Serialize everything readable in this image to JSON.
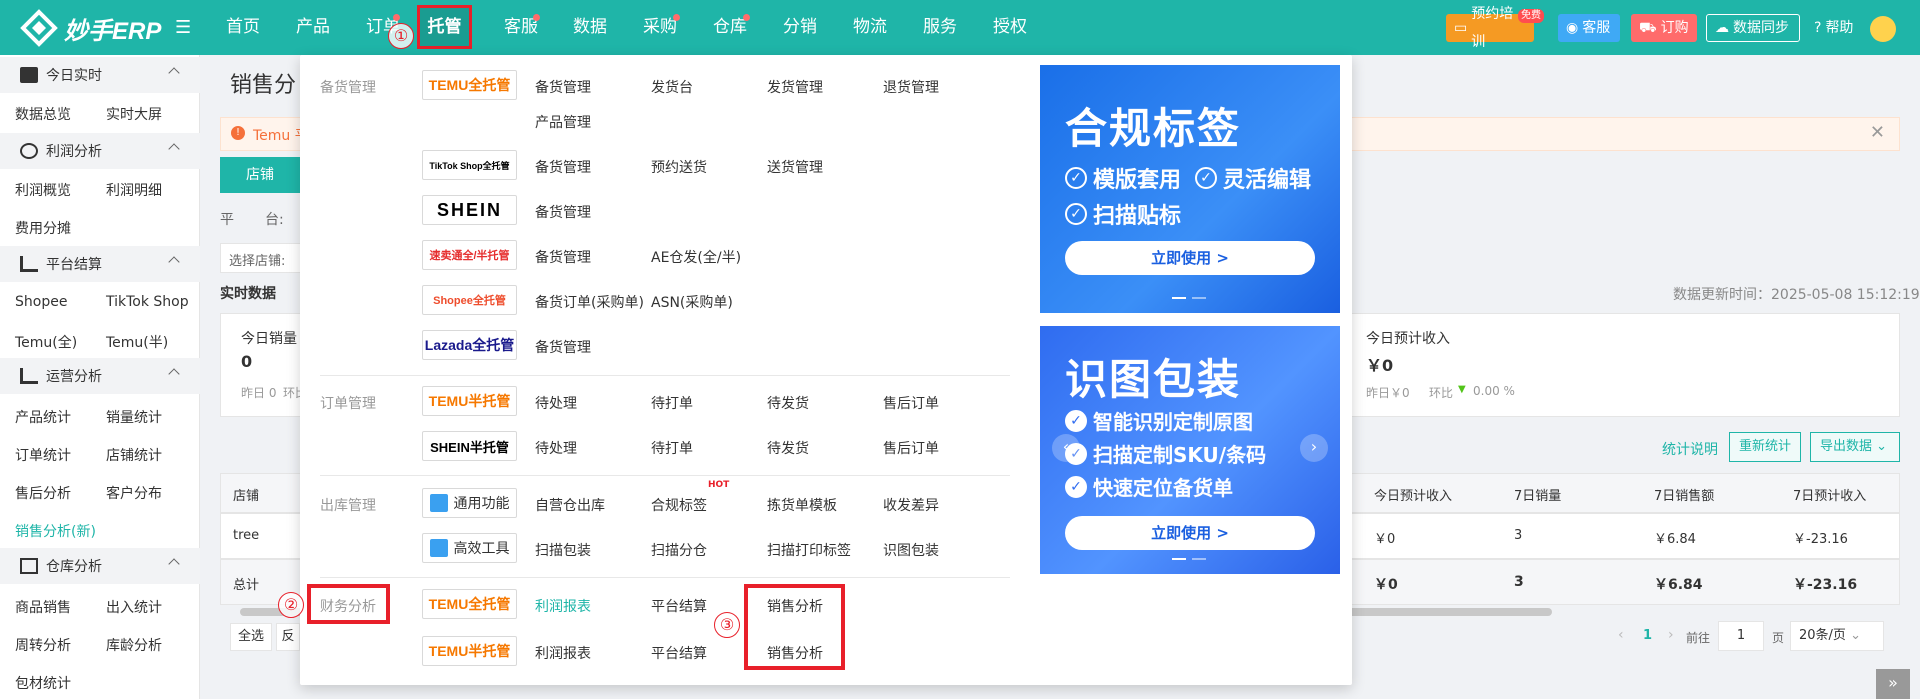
{
  "brand": {
    "name": "妙手ERP"
  },
  "nav": {
    "items": [
      "首页",
      "产品",
      "订单",
      "托管",
      "客服",
      "数据",
      "采购",
      "仓库",
      "分销",
      "物流",
      "服务",
      "授权"
    ],
    "active": "托管"
  },
  "topbar": {
    "training": "预约培训",
    "training_badge": "免费",
    "service": "客服",
    "subscribe": "订购",
    "sync": "数据同步",
    "help": "帮助"
  },
  "annotations": {
    "one": "①",
    "two": "②",
    "three": "③"
  },
  "sidebar": {
    "g1": "今日实时",
    "g1_items": [
      "数据总览",
      "实时大屏"
    ],
    "g2": "利润分析",
    "g2_items": [
      "利润概览",
      "利润明细",
      "费用分摊"
    ],
    "g3": "平台结算",
    "g3_items": [
      "Shopee",
      "TikTok Shop",
      "Temu(全)",
      "Temu(半)"
    ],
    "g4": "运营分析",
    "g4_items": [
      "产品统计",
      "销量统计",
      "订单统计",
      "店铺统计",
      "售后分析",
      "客户分布",
      "销售分析(新)"
    ],
    "g5": "仓库分析",
    "g5_items": [
      "商品销售",
      "出入统计",
      "周转分析",
      "库龄分析",
      "包材统计"
    ]
  },
  "page": {
    "title": "销售分",
    "notice": "Temu 平",
    "tab_shop": "店铺",
    "platform_label": "平",
    "platform_label2": "台:",
    "select_shop": "选择店铺:",
    "realtime": "实时数据",
    "updated": "数据更新时间：2025-05-08 15:12:19",
    "today_sales_label": "今日销量",
    "today_sales_value": "0",
    "yesterday": "昨日 0",
    "compare_short": "环比",
    "today_income_label": "今日预计收入",
    "today_income_value": "￥0",
    "income_yesterday": "昨日￥0",
    "compare": "环比",
    "income_pct": "0.00 %",
    "stats_desc": "统计说明",
    "recount": "重新统计",
    "export": "导出数据",
    "col_shop": "店铺",
    "cols": [
      "今日预计收入",
      "7日销量",
      "7日销售额",
      "7日预计收入"
    ],
    "row_shop": "tree",
    "row_vals": [
      "￥0",
      "3",
      "￥6.84",
      "￥-23.16"
    ],
    "total_label": "总计",
    "total_vals": [
      "￥0",
      "3",
      "￥6.84",
      "￥-23.16"
    ],
    "select_all": "全选",
    "invert": "反",
    "page_num": "1",
    "goto": "前往",
    "goto_value": "1",
    "page_unit": "页",
    "page_size": "20条/页"
  },
  "dropdown": {
    "sec_stock": "备货管理",
    "sec_order": "订单管理",
    "sec_out": "出库管理",
    "sec_fin": "财务分析",
    "temu_full": "TEMU全托管",
    "tiktok_full": "TikTok Shop全托管",
    "shein": "SHEIN",
    "sumaitong": "速卖通全/半托管",
    "shopee_full": "Shopee全托管",
    "lazada_full": "Lazada全托管",
    "temu_half": "TEMU半托管",
    "shein_half": "SHEIN半托管",
    "general": "通用功能",
    "tools": "高效工具",
    "r1": [
      "备货管理",
      "发货台",
      "发货管理",
      "退货管理"
    ],
    "r1b": "产品管理",
    "r2": [
      "备货管理",
      "预约送货",
      "送货管理"
    ],
    "r3": "备货管理",
    "r4": [
      "备货管理",
      "AE仓发(全/半)"
    ],
    "r5": [
      "备货订单(采购单)",
      "ASN(采购单)"
    ],
    "r6": "备货管理",
    "o1": [
      "待处理",
      "待打单",
      "待发货",
      "售后订单"
    ],
    "o2": [
      "待处理",
      "待打单",
      "待发货",
      "售后订单"
    ],
    "w1": [
      "自营仓出库",
      "合规标签",
      "拣货单模板",
      "收发差异"
    ],
    "w1_hot": "HOT",
    "w2": [
      "扫描包装",
      "扫描分仓",
      "扫描打印标签",
      "识图包装"
    ],
    "f1": [
      "利润报表",
      "平台结算",
      "销售分析"
    ],
    "f2": [
      "利润报表",
      "平台结算",
      "销售分析"
    ]
  },
  "banners": {
    "b1_title": "合规标签",
    "b1_feats": [
      "模版套用",
      "灵活编辑",
      "扫描贴标"
    ],
    "b1_cta": "立即使用 >",
    "b2_title": "识图包装",
    "b2_feats": [
      "智能识别定制原图",
      "扫描定制SKU/条码",
      "快速定位备货单"
    ],
    "b2_cta": "立即使用 >"
  },
  "colors": {
    "brand": "#1fb5a8",
    "accent_red": "#e8202a",
    "banner_blue": "#1a6fe8"
  }
}
